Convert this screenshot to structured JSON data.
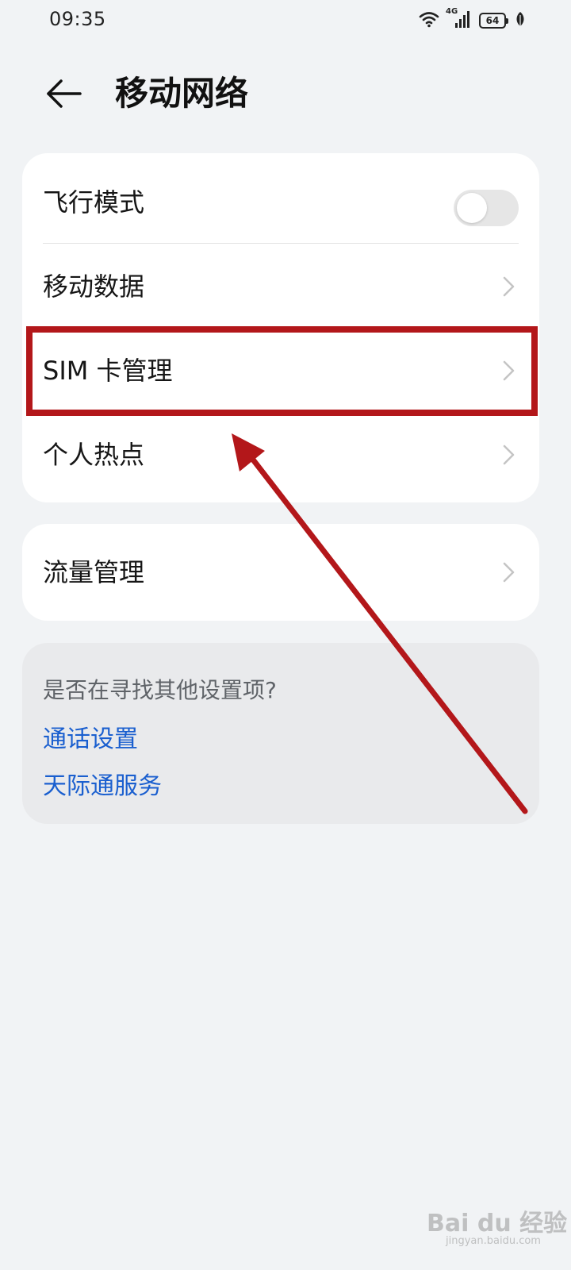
{
  "status_bar": {
    "time": "09:35",
    "network_type": "4G",
    "battery_level": "64",
    "icons": [
      "wifi-icon",
      "signal-icon",
      "battery-icon",
      "leaf-icon"
    ]
  },
  "header": {
    "back_icon": "arrow-left-icon",
    "title": "移动网络"
  },
  "main_card": {
    "airplane_mode": {
      "label": "飞行模式",
      "enabled": false
    },
    "mobile_data": {
      "label": "移动数据"
    },
    "sim_management": {
      "label": "SIM 卡管理"
    },
    "hotspot": {
      "label": "个人热点"
    }
  },
  "traffic_card": {
    "traffic_management": {
      "label": "流量管理"
    }
  },
  "suggestions": {
    "title": "是否在寻找其他设置项?",
    "links": [
      "通话设置",
      "天际通服务"
    ]
  },
  "colors": {
    "background": "#f1f3f5",
    "card": "#ffffff",
    "link": "#1a5fcf",
    "annotation": "#b3171a"
  },
  "watermark": {
    "text": "Bai du 经验",
    "sub": "jingyan.baidu.com"
  }
}
